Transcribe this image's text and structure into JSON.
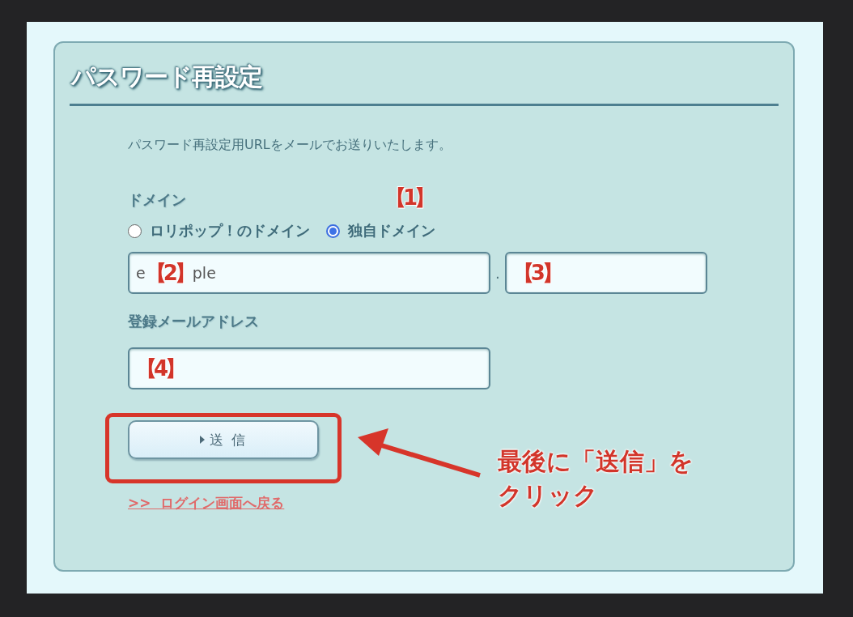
{
  "form": {
    "title": "パスワード再設定",
    "description": "パスワード再設定用URLをメールでお送りいたします。",
    "domain": {
      "label": "ドメイン",
      "marker": "【1】",
      "options": [
        {
          "label": "ロリポップ！のドメイン",
          "selected": false
        },
        {
          "label": "独自ドメイン",
          "selected": true
        }
      ]
    },
    "domain_fields": [
      {
        "value_before": "e",
        "marker": "【2】",
        "value_after": "ple"
      },
      {
        "marker": "【3】"
      }
    ],
    "separator": ".",
    "email": {
      "label": "登録メールアドレス",
      "marker": "【4】"
    },
    "submit": {
      "label": "送 信"
    },
    "back_link": ">>  ログイン画面へ戻る"
  },
  "callout": {
    "lines": [
      "最後に「送信」を",
      "クリック"
    ]
  }
}
